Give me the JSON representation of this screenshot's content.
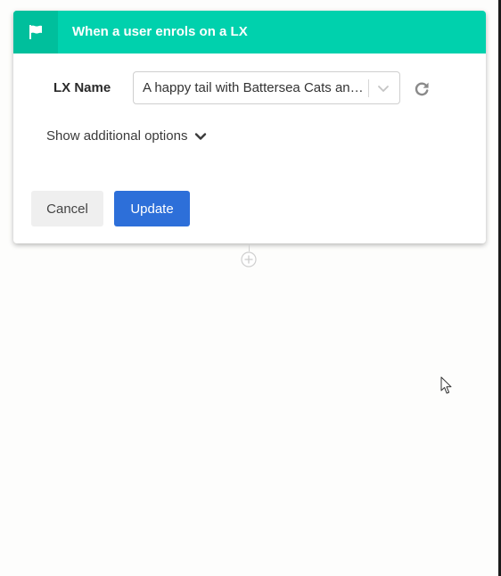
{
  "trigger": {
    "title": "When a user enrols on a LX",
    "icon": "flag-icon"
  },
  "form": {
    "lx_name_label": "LX Name",
    "lx_name_value": "A happy tail with Battersea Cats and Dogs Home",
    "dropdown_icon": "chevron-down-icon",
    "refresh_icon": "refresh-icon",
    "show_options_label": "Show additional options",
    "show_options_icon": "chevron-down-icon"
  },
  "actions": {
    "cancel_label": "Cancel",
    "update_label": "Update"
  },
  "flow": {
    "add_step_icon": "plus-circle-icon"
  },
  "colors": {
    "header": "#00d1ad",
    "header_icon_bg": "#00bf9c",
    "primary_button": "#2d6fd9",
    "secondary_button": "#efefef"
  }
}
